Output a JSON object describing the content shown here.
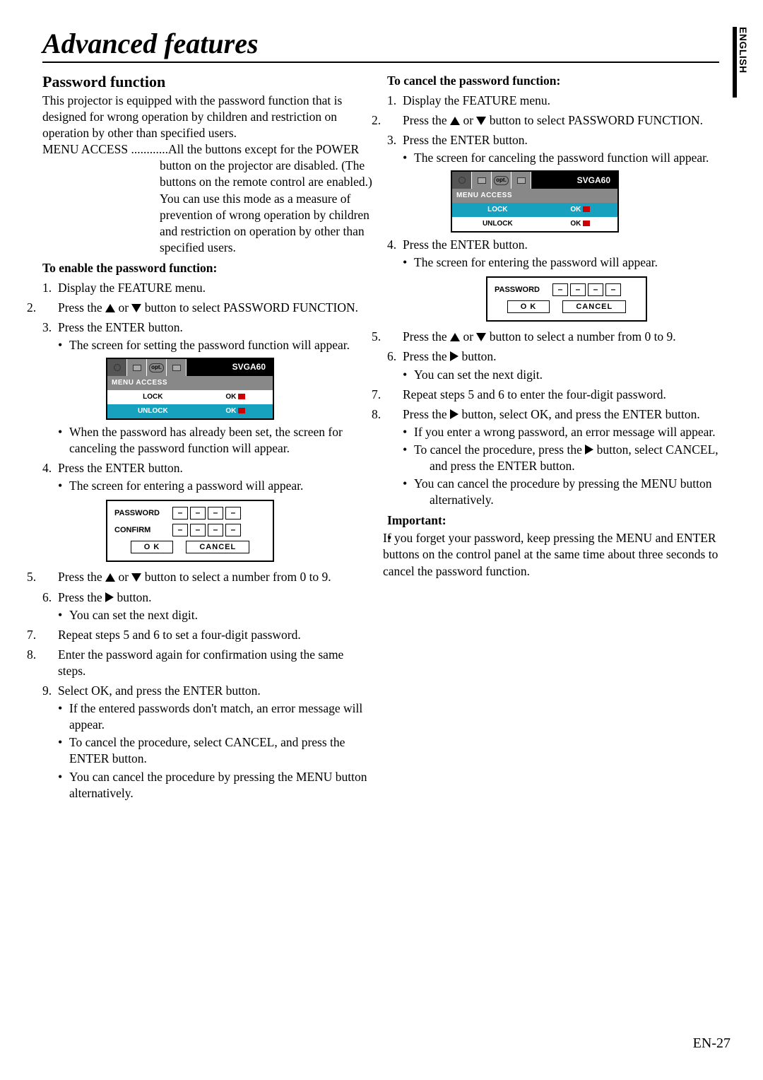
{
  "page": {
    "title": "Advanced features",
    "side_label": "ENGLISH",
    "page_number": "EN-27"
  },
  "left": {
    "heading": "Password function",
    "intro": "This projector is equipped with the password function that is designed for wrong operation by children and restriction on operation by other than specified users.",
    "menu_access_label": "MENU ACCESS ............",
    "menu_access_desc": "All the buttons except for the POWER button on the projector are disabled. (The buttons on the remote control are enabled.) You can use this mode as a measure of prevention of wrong operation by children and restriction on operation by other than specified users.",
    "enable_heading": "To enable the password function:",
    "step1": "Display the FEATURE menu.",
    "step2a": "Press the ",
    "step2b": " or ",
    "step2c": " button to select PASSWORD FUNCTION.",
    "step3": "Press the ENTER button.",
    "step3_bullet": "The screen for setting the password function will appear.",
    "menu1": {
      "mode": "SVGA60",
      "header": "MENU ACCESS",
      "row1": {
        "label": "LOCK",
        "action": "OK"
      },
      "row2": {
        "label": "UNLOCK",
        "action": "OK"
      }
    },
    "step3_bullet2": "When the password has already been set, the screen for canceling the password function will appear.",
    "step4": "Press the ENTER button.",
    "step4_bullet": "The screen for entering a password will appear.",
    "pw1": {
      "password_label": "PASSWORD",
      "confirm_label": "CONFIRM",
      "digit": "–",
      "ok": "O K",
      "cancel": "CANCEL"
    },
    "step5a": "Press the ",
    "step5b": " or ",
    "step5c": " button to select a number from 0 to 9.",
    "step6a": "Press the ",
    "step6b": " button.",
    "step6_bullet": "You can set the next digit.",
    "step7": "Repeat steps 5 and 6 to set a four-digit password.",
    "step8": "Enter the password again for confirmation using the same steps.",
    "step9": "Select OK, and press the ENTER button.",
    "step9_b1": "If the entered passwords don't match, an error message will appear.",
    "step9_b2": "To cancel the procedure, select CANCEL, and press the ENTER button.",
    "step9_b3": "You can cancel the procedure by pressing the MENU button alternatively."
  },
  "right": {
    "cancel_heading": "To cancel the password function:",
    "step1": "Display the FEATURE menu.",
    "step2a": "Press the ",
    "step2b": " or ",
    "step2c": " button to select PASSWORD FUNCTION.",
    "step3": "Press the ENTER button.",
    "step3_bullet": "The screen for canceling the password function will appear.",
    "menu2": {
      "mode": "SVGA60",
      "header": "MENU ACCESS",
      "row1": {
        "label": "LOCK",
        "action": "OK"
      },
      "row2": {
        "label": "UNLOCK",
        "action": "OK"
      }
    },
    "step4": "Press the ENTER button.",
    "step4_bullet": "The screen for entering the password will appear.",
    "pw2": {
      "password_label": "PASSWORD",
      "digit": "–",
      "ok": "O K",
      "cancel": "CANCEL"
    },
    "step5a": "Press the ",
    "step5b": " or ",
    "step5c": " button to select a number from 0 to 9.",
    "step6a": "Press the ",
    "step6b": " button.",
    "step6_bullet": "You can set the next digit.",
    "step7": "Repeat steps 5 and 6 to enter the four-digit password.",
    "step8a": "Press the ",
    "step8b": " button, select OK, and press the ENTER button.",
    "step8_b1": "If you enter a wrong password, an error message will appear.",
    "step8_b2a": "To cancel the procedure, press the ",
    "step8_b2b": " button, select CANCEL, and press the ENTER button.",
    "step8_b3": "You can cancel the procedure by pressing the MENU button alternatively.",
    "important_heading": "Important:",
    "important_text": "If you forget your password, keep pressing the MENU and ENTER buttons on the control panel at the same time about three seconds to cancel the password function."
  }
}
